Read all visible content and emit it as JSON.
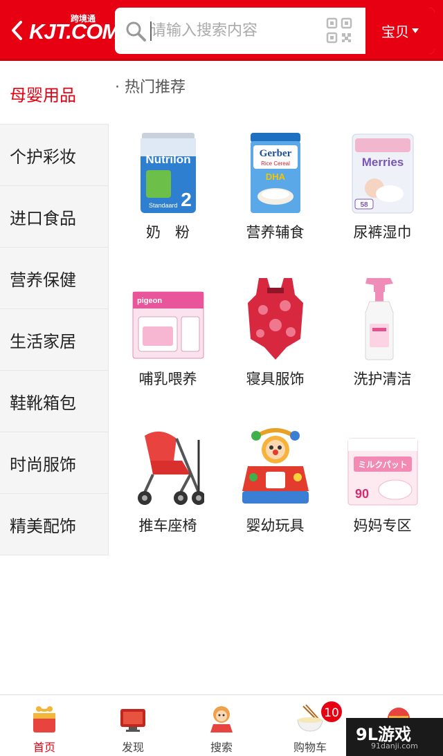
{
  "header": {
    "logo_text": "KJT.COM",
    "logo_subtext": "跨境通",
    "search_placeholder": "请输入搜索内容",
    "search_scope": "宝贝"
  },
  "sidebar": {
    "items": [
      {
        "label": "母婴用品",
        "active": true
      },
      {
        "label": "个护彩妆"
      },
      {
        "label": "进口食品"
      },
      {
        "label": "营养保健"
      },
      {
        "label": "生活家居"
      },
      {
        "label": "鞋靴箱包"
      },
      {
        "label": "时尚服饰"
      },
      {
        "label": "精美配饰"
      }
    ]
  },
  "main": {
    "section_title": "· 热门推荐",
    "items": [
      {
        "label": "奶　粉",
        "icon": "milk-powder-can"
      },
      {
        "label": "营养辅食",
        "icon": "cereal-can"
      },
      {
        "label": "尿裤湿巾",
        "icon": "diaper-pack"
      },
      {
        "label": "哺乳喂养",
        "icon": "sterilizer-box"
      },
      {
        "label": "寝具服饰",
        "icon": "baby-swimsuit"
      },
      {
        "label": "洗护清洁",
        "icon": "spray-bottle"
      },
      {
        "label": "推车座椅",
        "icon": "stroller"
      },
      {
        "label": "婴幼玩具",
        "icon": "activity-toy"
      },
      {
        "label": "妈妈专区",
        "icon": "nursing-pads"
      }
    ],
    "product_texts": {
      "nutrilon_brand": "Nutrilon",
      "nutrilon_variant": "Standaard",
      "nutrilon_stage": "2",
      "gerber_brand": "Gerber",
      "gerber_line": "Rice Cereal",
      "gerber_tag": "DHA",
      "merries_brand": "Merries",
      "merries_size": "58",
      "pigeon_brand": "pigeon",
      "pads_title": "ミルクパット",
      "pads_count": "90"
    }
  },
  "tabbar": {
    "items": [
      {
        "label": "首页",
        "active": true
      },
      {
        "label": "发现"
      },
      {
        "label": "搜索"
      },
      {
        "label": "购物车"
      },
      {
        "label": ""
      }
    ],
    "cart_badge": "10"
  },
  "watermark": {
    "main": "9L游戏",
    "sub": "91danji.com"
  },
  "colors": {
    "brand_red": "#e60012",
    "sidebar_bg": "#f5f5f5",
    "text": "#222222"
  }
}
